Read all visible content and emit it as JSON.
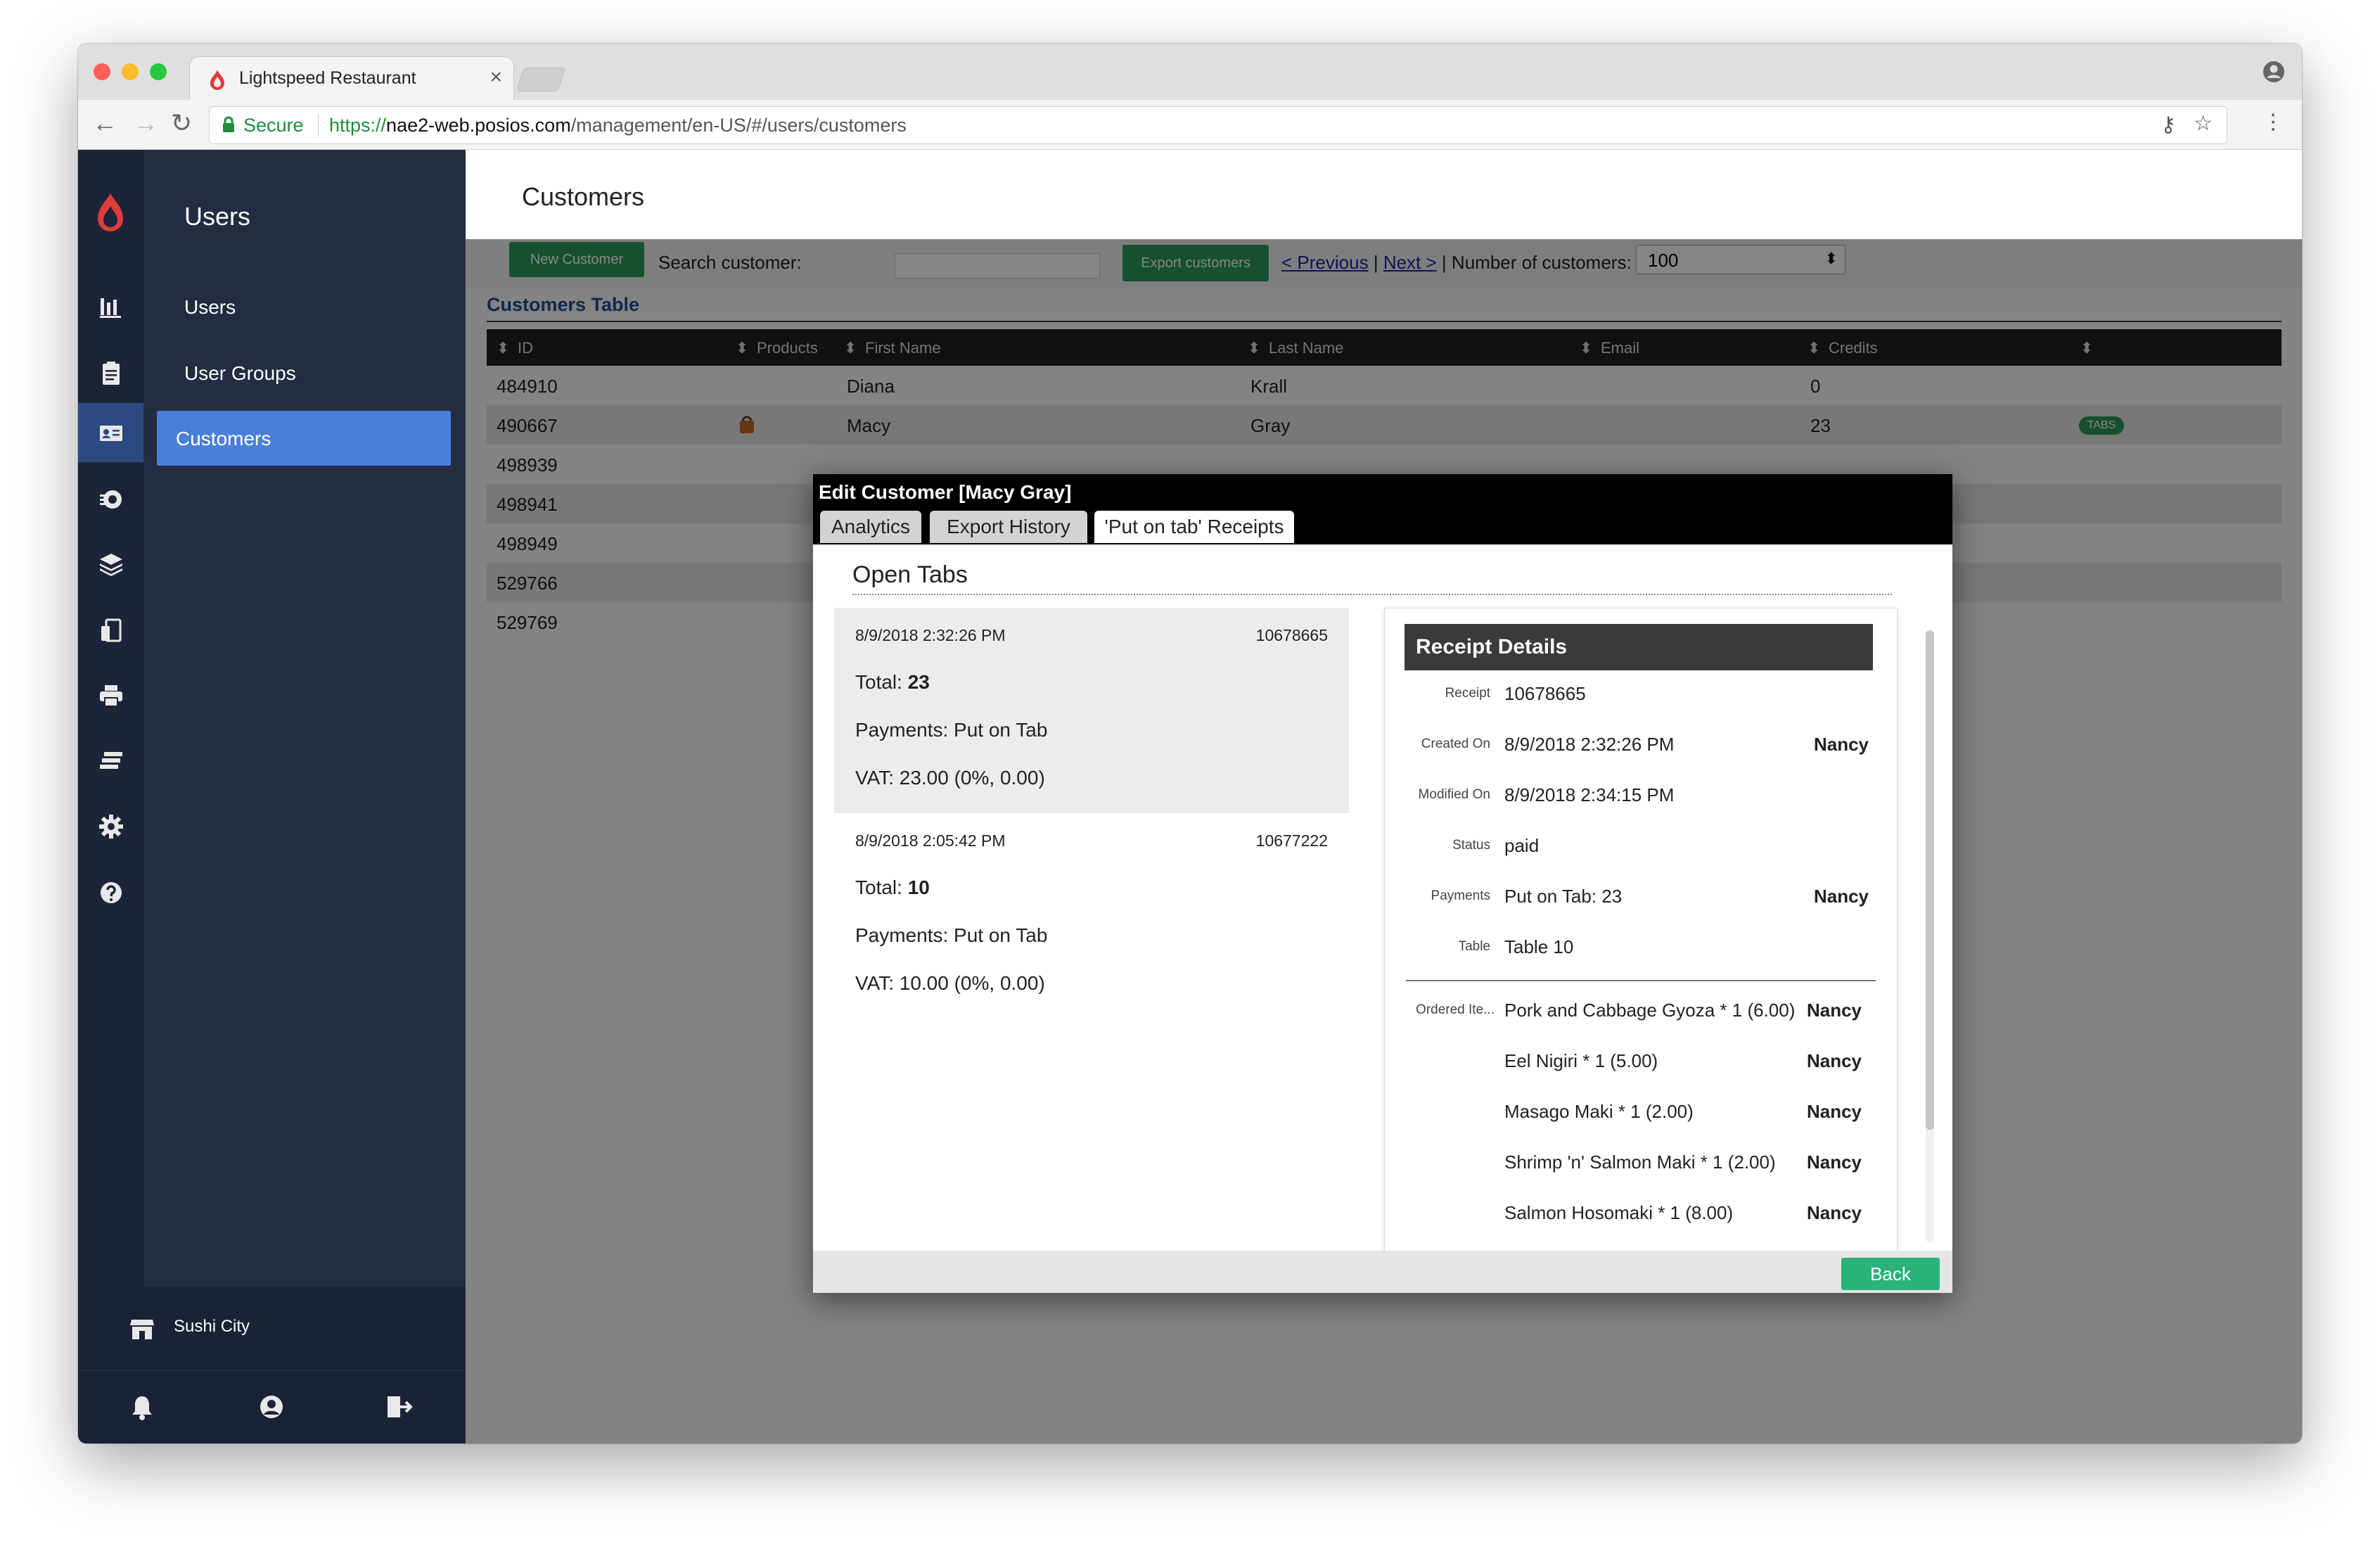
{
  "browser": {
    "tab_title": "Lightspeed Restaurant",
    "tab_close": "×",
    "secure_label": "Secure",
    "url_scheme": "https://",
    "url_host": "nae2-web.posios.com",
    "url_path": "/management/en-US/#/users/customers",
    "back": "←",
    "forward": "→",
    "reload": "↻",
    "key": "⚷",
    "star": "☆",
    "menu": "⋮"
  },
  "sidebar": {
    "title": "Users",
    "items": [
      {
        "label": "Users"
      },
      {
        "label": "User Groups"
      },
      {
        "label": "Customers"
      }
    ],
    "store_name": "Sushi City"
  },
  "page": {
    "title": "Customers",
    "new_customer": "New Customer",
    "search_label": "Search customer:",
    "export": "Export customers",
    "previous": "< Previous",
    "separator": "|",
    "next": "Next >",
    "count_label": "Number of customers:",
    "count_value": "100",
    "select_arrow": "⬍",
    "table_label": "Customers Table"
  },
  "table": {
    "headers": [
      "ID",
      "Products",
      "First Name",
      "Last Name",
      "Email",
      "Credits"
    ],
    "sort_icon": "⬍",
    "rows": [
      {
        "id": "484910",
        "first": "Diana",
        "last": "Krall",
        "credits": "0"
      },
      {
        "id": "490667",
        "first": "Macy",
        "last": "Gray",
        "credits": "23",
        "badge": "TABS"
      },
      {
        "id": "498939"
      },
      {
        "id": "498941"
      },
      {
        "id": "498949"
      },
      {
        "id": "529766"
      },
      {
        "id": "529769"
      }
    ]
  },
  "modal": {
    "title": "Edit Customer [Macy Gray]",
    "tabs": [
      "Analytics",
      "Export History",
      "'Put on tab' Receipts"
    ],
    "section_title": "Open Tabs",
    "receipts": [
      {
        "date": "8/9/2018 2:32:26 PM",
        "number": "10678665",
        "total_label": "Total: ",
        "total": "23",
        "payments": "Payments: Put on Tab",
        "vat": "VAT: 23.00 (0%, 0.00)"
      },
      {
        "date": "8/9/2018 2:05:42 PM",
        "number": "10677222",
        "total_label": "Total: ",
        "total": "10",
        "payments": "Payments: Put on Tab",
        "vat": "VAT: 10.00 (0%, 0.00)"
      }
    ],
    "details": {
      "header": "Receipt Details",
      "fields": [
        {
          "label": "Receipt",
          "value": "10678665",
          "user": ""
        },
        {
          "label": "Created On",
          "value": "8/9/2018 2:32:26 PM",
          "user": "Nancy"
        },
        {
          "label": "Modified On",
          "value": "8/9/2018 2:34:15 PM",
          "user": ""
        },
        {
          "label": "Status",
          "value": "paid",
          "user": ""
        },
        {
          "label": "Payments",
          "value": "Put on Tab: 23",
          "user": "Nancy"
        },
        {
          "label": "Table",
          "value": "Table 10",
          "user": ""
        }
      ],
      "items_label": "Ordered Ite...",
      "items": [
        {
          "name": "Pork and Cabbage Gyoza * 1 (6.00)",
          "user": "Nancy"
        },
        {
          "name": "Eel Nigiri * 1 (5.00)",
          "user": "Nancy"
        },
        {
          "name": "Masago Maki * 1 (2.00)",
          "user": "Nancy"
        },
        {
          "name": "Shrimp 'n' Salmon Maki * 1 (2.00)",
          "user": "Nancy"
        },
        {
          "name": "Salmon Hosomaki * 1 (8.00)",
          "user": "Nancy"
        }
      ]
    },
    "back_label": "Back"
  },
  "colors": {
    "sidebar_bg": "#232c42",
    "rail_bg": "#1c2438",
    "active_item": "#4a7fd9",
    "brand_red": "#e03a3a",
    "button_green": "#2ab27b",
    "secure_green": "#1e8e3e"
  }
}
